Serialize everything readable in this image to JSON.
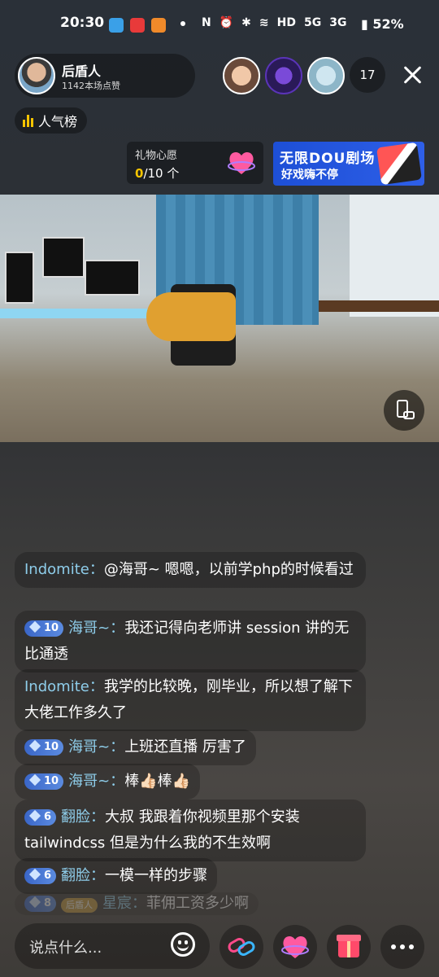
{
  "status_bar": {
    "time": "20:30",
    "battery": "52%",
    "signal_labels": [
      "HD",
      "5G",
      "3G"
    ]
  },
  "host": {
    "name": "后盾人",
    "likes": "1142本场点赞"
  },
  "viewers": {
    "count": "17"
  },
  "rank": {
    "label": "人气榜"
  },
  "gift_wish": {
    "title": "礼物心愿",
    "current": "0",
    "total": "/10 个"
  },
  "banner": {
    "line1": "无限DOU剧场",
    "line2": "好戏嗨不停"
  },
  "comments": [
    {
      "badge": "",
      "name": "Indomite：",
      "text": "@海哥~ 嗯嗯，以前学php的时候看过"
    },
    {
      "badge": "10",
      "name": "海哥~：",
      "text": "我还记得向老师讲 session 讲的无比通透"
    },
    {
      "badge": "",
      "name": "Indomite：",
      "text": "我学的比较晚，刚毕业，所以想了解下大佬工作多久了"
    },
    {
      "badge": "10",
      "name": "海哥~：",
      "text": "上班还直播 厉害了"
    },
    {
      "badge": "10",
      "name": "海哥~：",
      "text": "棒👍🏻棒👍🏻"
    },
    {
      "badge": "6",
      "name": "翻脸：",
      "text": "大叔  我跟着你视频里那个安装 tailwindcss  但是为什么我的不生效啊"
    },
    {
      "badge": "6",
      "name": "翻脸：",
      "text": "一模一样的步骤"
    },
    {
      "badge": "8",
      "fan": "后盾人",
      "name": "星宸：",
      "text": "菲佣工资多少啊"
    }
  ],
  "input": {
    "placeholder": "说点什么..."
  },
  "colors": {
    "accent_gold": "#f5c400",
    "nick_blue": "#8ecdea",
    "badge_blue": "#3a66c8"
  }
}
